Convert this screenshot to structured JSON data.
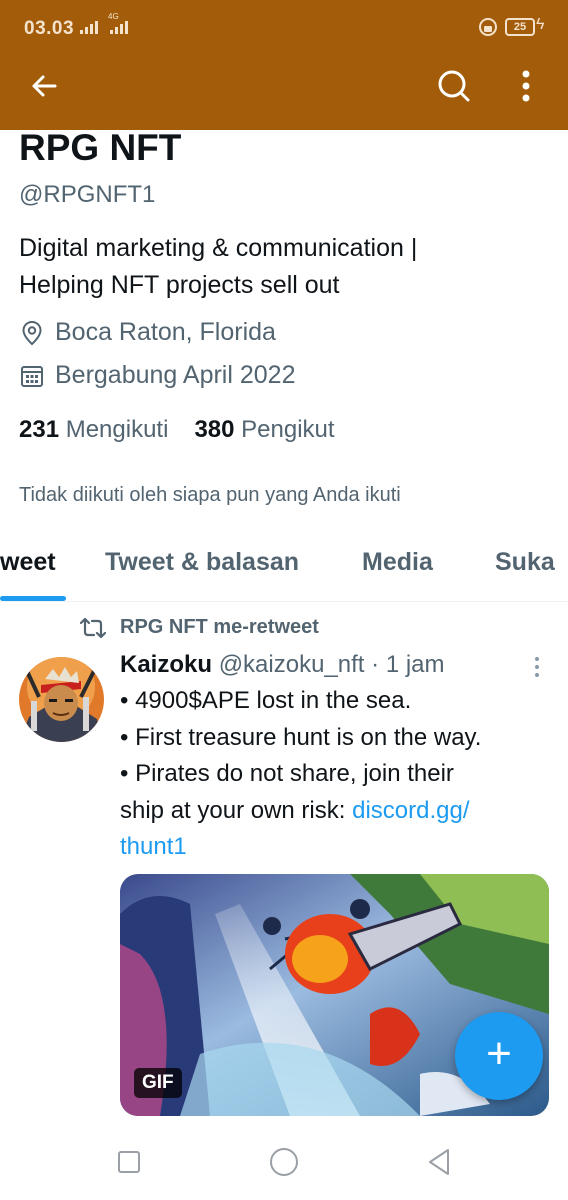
{
  "status_bar": {
    "time": "03.03",
    "network": "4G",
    "battery": "25"
  },
  "app_bar": {
    "back_icon": "arrow-left-icon",
    "search_icon": "search-icon",
    "more_icon": "more-vertical-icon"
  },
  "profile": {
    "name": "RPG NFT",
    "handle": "@RPGNFT1",
    "bio_line1": "Digital marketing & communication |",
    "bio_line2": "Helping NFT projects sell out",
    "location": "Boca Raton, Florida",
    "joined": "Bergabung April 2022",
    "following_count": "231",
    "following_label": "Mengikuti",
    "followers_count": "380",
    "followers_label": "Pengikut",
    "not_followed_text": "Tidak diikuti oleh siapa pun yang Anda ikuti"
  },
  "tabs": [
    {
      "label": "weet"
    },
    {
      "label": "Tweet & balasan"
    },
    {
      "label": "Media"
    },
    {
      "label": "Suka"
    }
  ],
  "tweet": {
    "retweet_label": "RPG NFT me-retweet",
    "author_name": "Kaizoku",
    "author_handle": "@kaizoku_nft",
    "separator": "·",
    "time": "1 jam",
    "line1": "• 4900$APE lost in the sea.",
    "line2": "• First treasure hunt is on the way.",
    "line3": "• Pirates do not share, join their",
    "line4_prefix": "ship at your own risk: ",
    "link_part1": "discord.gg/",
    "link_part2": "thunt1",
    "media_badge": "GIF"
  },
  "fab": {
    "label": "+"
  },
  "colors": {
    "app_bar": "#a35c0a",
    "accent": "#1d9bf0",
    "secondary_text": "#536471",
    "primary_text": "#0f1419"
  }
}
